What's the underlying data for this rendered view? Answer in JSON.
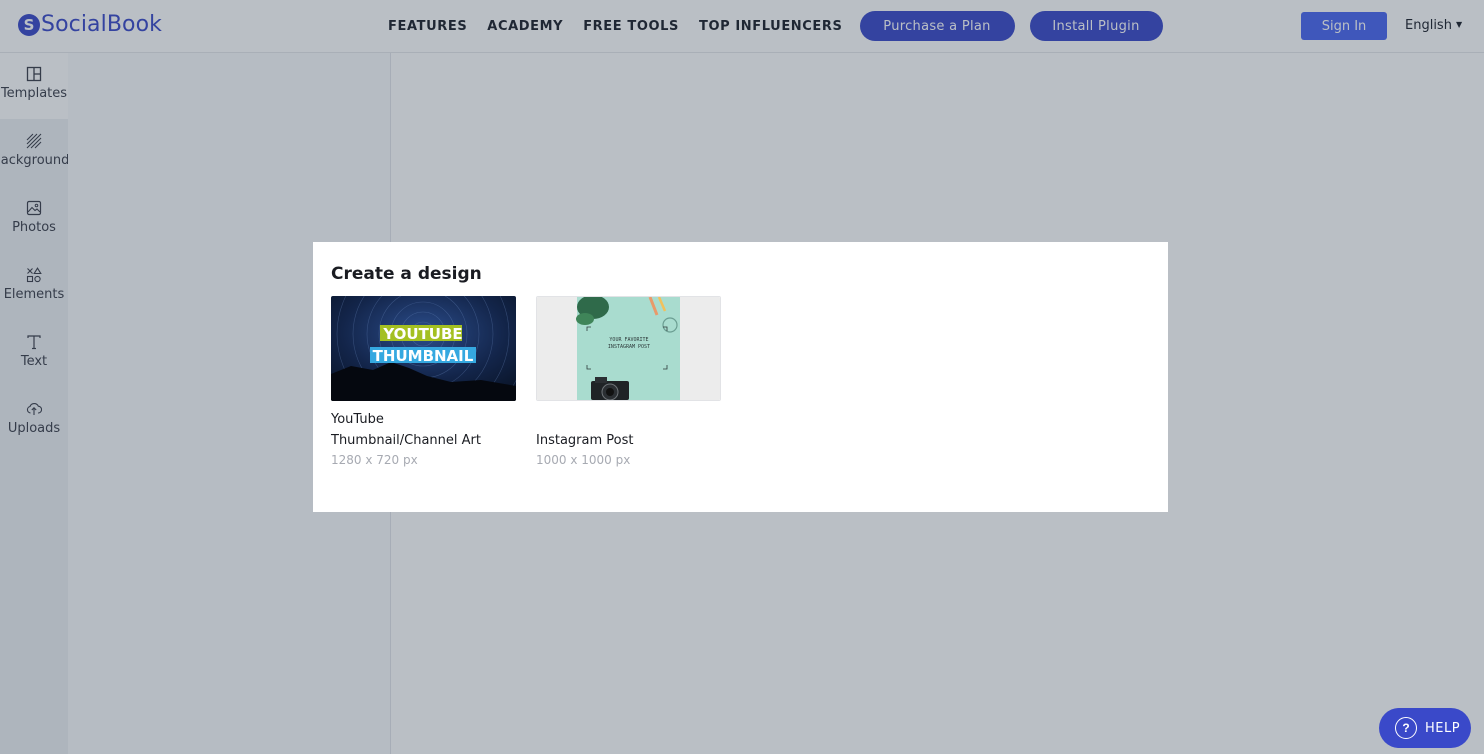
{
  "brand": {
    "name": "SocialBook",
    "mark": "S"
  },
  "nav": {
    "links": [
      "FEATURES",
      "ACADEMY",
      "FREE TOOLS",
      "TOP INFLUENCERS"
    ],
    "purchase_label": "Purchase a Plan",
    "plugin_label": "Install Plugin",
    "signin_label": "Sign In",
    "language": "English"
  },
  "sidebar": {
    "items": [
      {
        "label": "Templates",
        "icon": "templates-icon"
      },
      {
        "label": "Backgrounds",
        "icon": "backgrounds-icon"
      },
      {
        "label": "Photos",
        "icon": "photos-icon"
      },
      {
        "label": "Elements",
        "icon": "elements-icon"
      },
      {
        "label": "Text",
        "icon": "text-icon"
      },
      {
        "label": "Uploads",
        "icon": "uploads-icon"
      }
    ]
  },
  "modal": {
    "title": "Create a design",
    "designs": [
      {
        "name": "YouTube Thumbnail/Channel Art",
        "name_line1": "YouTube",
        "name_line2": "Thumbnail/Channel Art",
        "size": "1280 x 720 px",
        "thumb_line1": "YOUTUBE",
        "thumb_line2": "THUMBNAIL"
      },
      {
        "name": "Instagram Post",
        "size": "1000 x 1000 px",
        "thumb_line1": "YOUR FAVORITE",
        "thumb_line2": "INSTAGRAM POST"
      }
    ]
  },
  "help": {
    "label": "HELP",
    "icon_glyph": "?"
  },
  "colors": {
    "brand_blue": "#3a49c9",
    "signin_blue": "#4b66f0",
    "overlay": "rgba(40,55,75,0.32)"
  }
}
